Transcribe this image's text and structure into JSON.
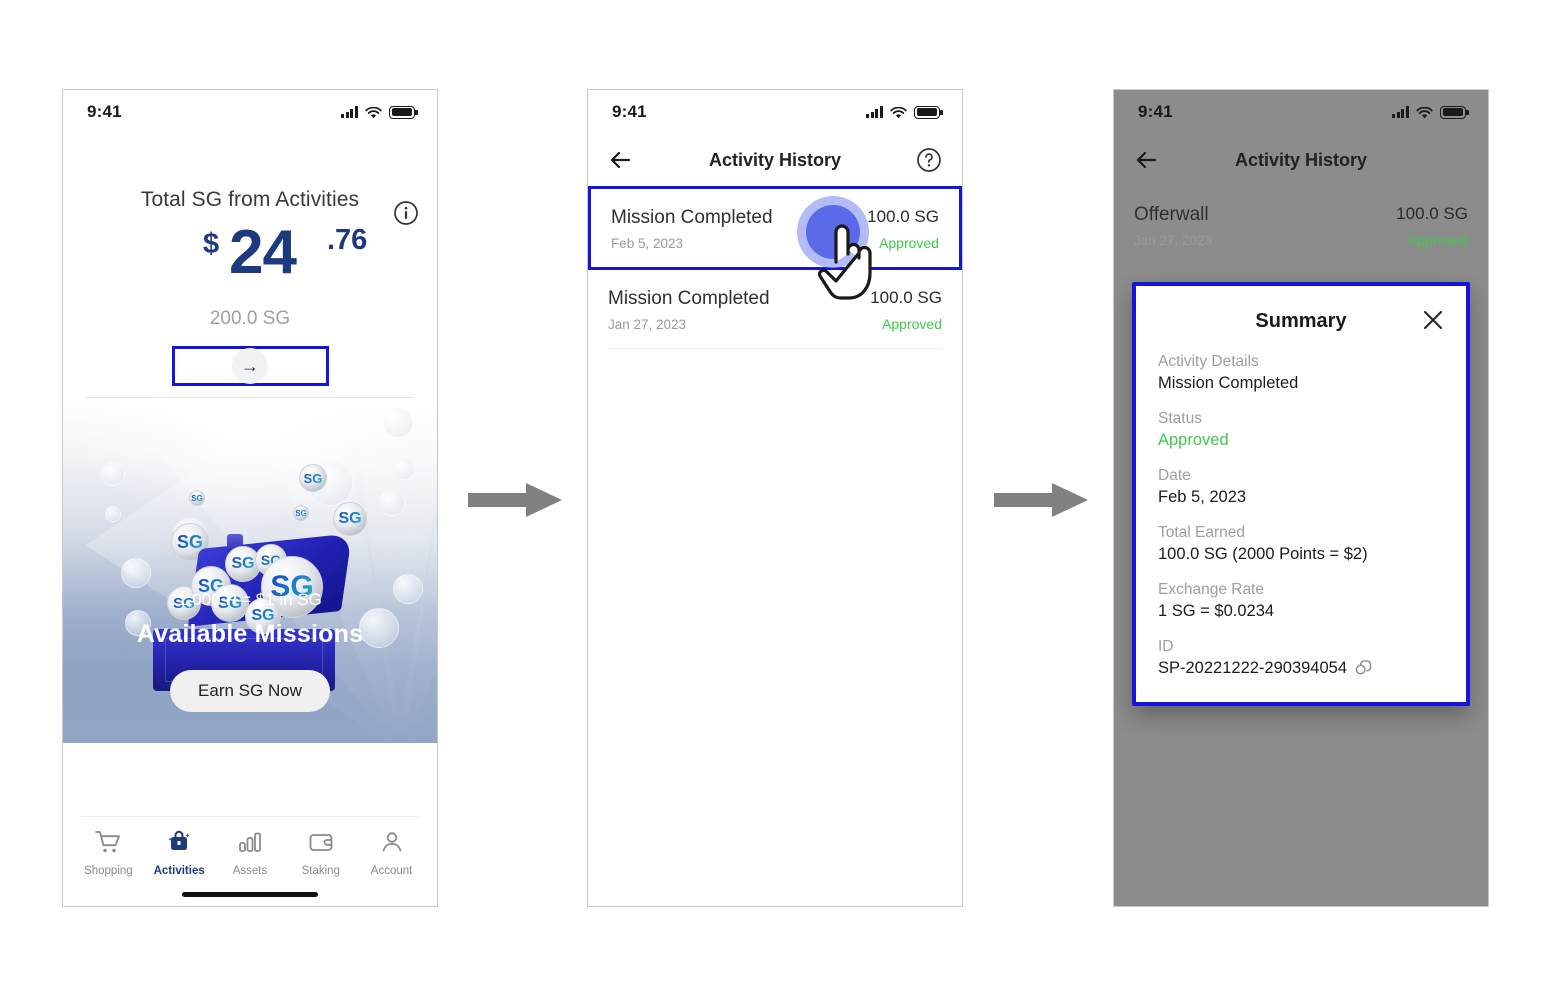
{
  "statusbar": {
    "time": "9:41"
  },
  "screen1": {
    "info_icon": "info-icon",
    "title": "Total SG from Activities",
    "currency_symbol": "$",
    "amount_int": "24",
    "amount_dec": ".76",
    "sg_balance": "200.0 SG",
    "arrow_label": "→",
    "banner": {
      "rate_text": "1,000 P = $1 in SG",
      "missions_text": "Available Missions",
      "cta_label": "Earn SG Now",
      "coin_symbol": "SG"
    },
    "nav": [
      {
        "label": "Shopping",
        "icon": "cart-icon",
        "active": false
      },
      {
        "label": "Activities",
        "icon": "activities-bag-icon",
        "active": true
      },
      {
        "label": "Assets",
        "icon": "bar-chart-icon",
        "active": false
      },
      {
        "label": "Staking",
        "icon": "wallet-icon",
        "active": false
      },
      {
        "label": "Account",
        "icon": "person-icon",
        "active": false
      }
    ]
  },
  "screen2": {
    "appbar": {
      "title": "Activity History",
      "back_icon": "back-arrow-icon",
      "help_icon": "help-circle-icon"
    },
    "rows": [
      {
        "title": "Mission Completed",
        "date": "Feb 5, 2023",
        "amount": "100.0 SG",
        "status": "Approved",
        "selected": true
      },
      {
        "title": "Mission Completed",
        "date": "Jan 27, 2023",
        "amount": "100.0 SG",
        "status": "Approved",
        "selected": false
      }
    ]
  },
  "screen3": {
    "appbar": {
      "title": "Activity History",
      "back_icon": "back-arrow-icon"
    },
    "row": {
      "title": "Offerwall",
      "date": "Jan 27, 2023",
      "amount": "100.0 SG",
      "status": "Approved"
    },
    "modal": {
      "title": "Summary",
      "close_icon": "close-x-icon",
      "fields": [
        {
          "label": "Activity Details",
          "value": "Mission Completed",
          "green": false,
          "copy": false
        },
        {
          "label": "Status",
          "value": "Approved",
          "green": true,
          "copy": false
        },
        {
          "label": "Date",
          "value": "Feb 5, 2023",
          "green": false,
          "copy": false
        },
        {
          "label": "Total Earned",
          "value": "100.0 SG (2000 Points = $2)",
          "green": false,
          "copy": false
        },
        {
          "label": "Exchange Rate",
          "value": "1 SG = $0.0234",
          "green": false,
          "copy": false
        },
        {
          "label": "ID",
          "value": "SP-20221222-290394054",
          "green": false,
          "copy": true
        }
      ]
    }
  },
  "colors": {
    "highlight": "#1414dc",
    "brand_navy": "#1e3a7e",
    "approved_green": "#3ec94a",
    "connector_gray": "#808080",
    "dim_overlay": "#8c8c8c"
  },
  "connectors": [
    {
      "icon": "right-arrow-connector"
    },
    {
      "icon": "right-arrow-connector"
    }
  ]
}
